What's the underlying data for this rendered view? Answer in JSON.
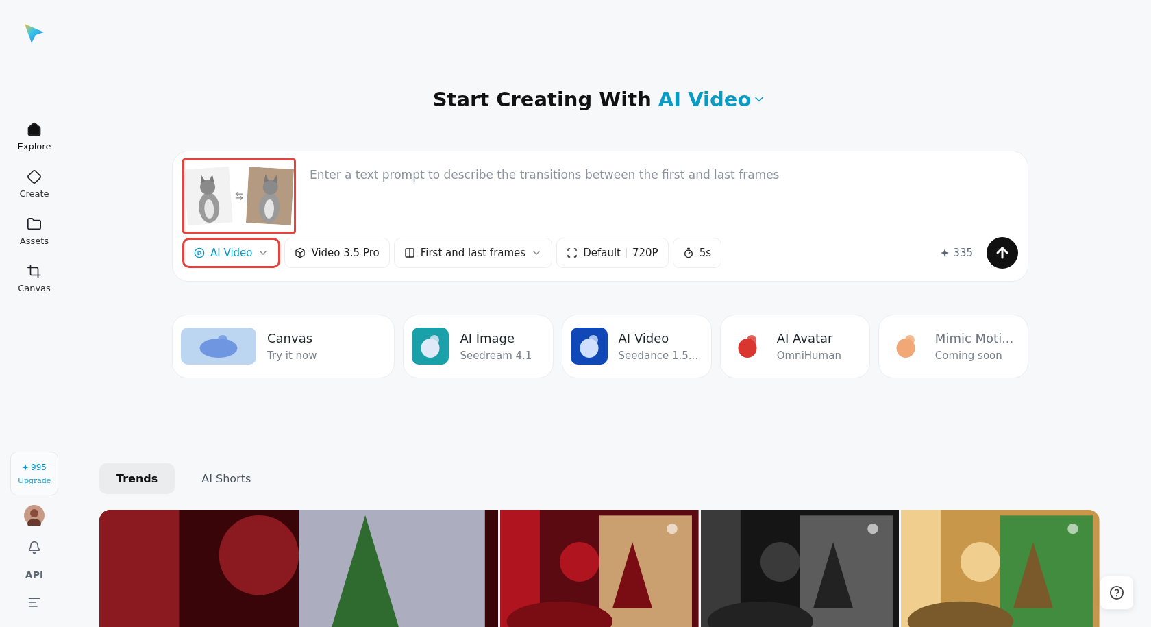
{
  "sidebar": {
    "nav": [
      {
        "label": "Explore",
        "selected": true
      },
      {
        "label": "Create",
        "selected": false
      },
      {
        "label": "Assets",
        "selected": false
      },
      {
        "label": "Canvas",
        "selected": false
      }
    ],
    "credits": {
      "count": "995",
      "action": "Upgrade"
    },
    "api_label": "API"
  },
  "heading": {
    "text": "Start Creating With",
    "mode": "AI Video"
  },
  "prompt": {
    "frames_highlighted": true,
    "placeholder": "Enter a text prompt to describe the transitions between the first and last frames",
    "options": [
      {
        "kind": "mode",
        "label": "AI Video",
        "highlighted": true
      },
      {
        "kind": "model",
        "label": "Video 3.5 Pro"
      },
      {
        "kind": "frames",
        "label": "First and last frames"
      },
      {
        "kind": "ratio",
        "label": "Default",
        "extra": "720P"
      },
      {
        "kind": "duration",
        "label": "5s"
      }
    ],
    "cost": "335"
  },
  "features": [
    {
      "title": "Canvas",
      "subtitle": "Try it now",
      "disabled": false
    },
    {
      "title": "AI Image",
      "subtitle": "Seedream 4.1",
      "disabled": false
    },
    {
      "title": "AI Video",
      "subtitle": "Seedance 1.5...",
      "disabled": false
    },
    {
      "title": "AI Avatar",
      "subtitle": "OmniHuman",
      "disabled": false
    },
    {
      "title": "Mimic Moti...",
      "subtitle": "Coming soon",
      "disabled": true
    }
  ],
  "tabs": [
    {
      "label": "Trends",
      "selected": true
    },
    {
      "label": "AI Shorts",
      "selected": false
    }
  ]
}
